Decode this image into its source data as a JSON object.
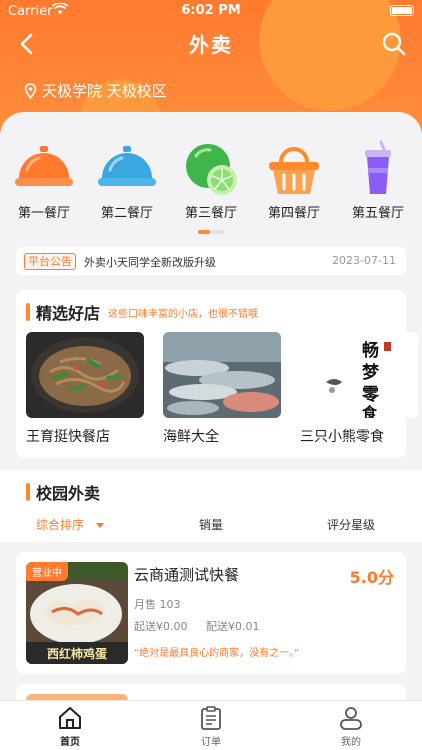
{
  "status_bar": {
    "carrier": "Carrier",
    "time": "6:02 PM"
  },
  "nav": {
    "title": "外卖"
  },
  "location": {
    "text": "天极学院 天极校区"
  },
  "categories": [
    {
      "label": "第一餐厅",
      "icon": "cloche-orange-icon",
      "color": "#ff7a2e"
    },
    {
      "label": "第二餐厅",
      "icon": "cloche-blue-icon",
      "color": "#3aa8e0"
    },
    {
      "label": "第三餐厅",
      "icon": "lime-icon",
      "color": "#4cc24a"
    },
    {
      "label": "第四餐厅",
      "icon": "basket-icon",
      "color": "#ff8a2e"
    },
    {
      "label": "第五餐厅",
      "icon": "drink-cup-icon",
      "color": "#8b5cf6"
    }
  ],
  "notice": {
    "tag": "平台公告",
    "text": "外卖小天同学全新改版升级",
    "date": "2023-07-11"
  },
  "featured": {
    "title": "精选好店",
    "subtitle": "这些口味丰富的小店，也很不错哦",
    "shops": [
      {
        "name": "王育挺快餐店"
      },
      {
        "name": "海鲜大全"
      },
      {
        "name": "三只小熊零食",
        "logo_text": "畅梦零食"
      }
    ]
  },
  "campus": {
    "title": "校园外卖",
    "sort": [
      "综合排序",
      "销量",
      "评分星级"
    ]
  },
  "stores": [
    {
      "badge": "营业中",
      "name": "云商通测试快餐",
      "rating": "5.0分",
      "sales": "月售 103",
      "min_order": "起送¥0.00",
      "delivery_fee": "配送¥0.01",
      "quote": "“绝对是最具良心的商家，没有之一。”",
      "image_text": "西红柿鸡蛋"
    }
  ],
  "tabbar": [
    {
      "label": "首页",
      "icon": "home-icon",
      "active": true
    },
    {
      "label": "订单",
      "icon": "clipboard-icon",
      "active": false
    },
    {
      "label": "我的",
      "icon": "user-icon",
      "active": false
    }
  ],
  "colors": {
    "accent": "#ff7a2e",
    "background": "#f3f3f5"
  }
}
